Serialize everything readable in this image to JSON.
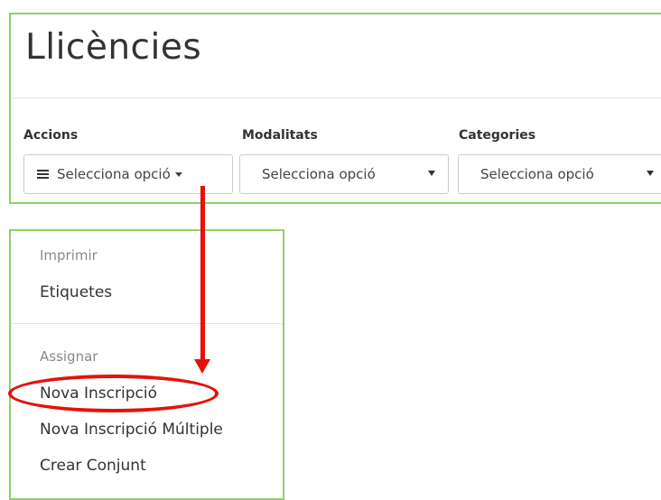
{
  "page": {
    "title": "Llicències"
  },
  "filters": {
    "accions": {
      "label": "Accions",
      "value": "Selecciona opció"
    },
    "modalitats": {
      "label": "Modalitats",
      "value": "Selecciona opció"
    },
    "categories": {
      "label": "Categories",
      "value": "Selecciona opció"
    }
  },
  "menu": {
    "header_imprimir": "Imprimir",
    "item_etiquetes": "Etiquetes",
    "header_assignar": "Assignar",
    "item_nova_inscripcio": "Nova Inscripció",
    "item_nova_inscripcio_multiple": "Nova Inscripció Múltiple",
    "item_crear_conjunt": "Crear Conjunt"
  },
  "annotation": {
    "color": "#e3120b"
  },
  "icons": {
    "accions": "list-icon",
    "accions_caret": "caret-down-icon",
    "select_caret": "caret-down-icon"
  },
  "colors": {
    "panel_border": "#8fd16a"
  }
}
